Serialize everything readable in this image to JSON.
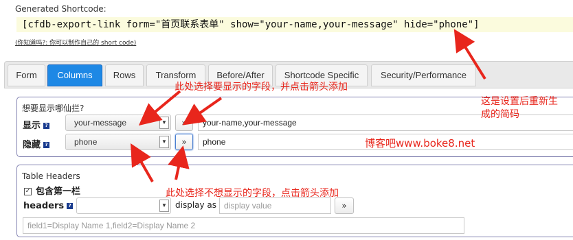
{
  "header": {
    "generated_label": "Generated Shortcode:",
    "shortcode": "[cfdb-export-link form=\"首页联系表单\" show=\"your-name,your-message\" hide=\"phone\"]",
    "hint_link": "(你知道吗?: 你可以制作自己的 short code)"
  },
  "tabs": [
    {
      "label": "Form"
    },
    {
      "label": "Columns"
    },
    {
      "label": "Rows"
    },
    {
      "label": "Transform"
    },
    {
      "label": "Before/After"
    },
    {
      "label": "Shortcode Specific"
    },
    {
      "label": "Security/Performance"
    }
  ],
  "columns_panel": {
    "legend": "想要显示哪仙拦?",
    "show_label": "显示",
    "show_select": "your-message",
    "show_value": "your-name,your-message",
    "hide_label": "隐藏",
    "hide_select": "phone",
    "hide_value": "phone",
    "add_button": "»"
  },
  "headers_panel": {
    "legend": "Table Headers",
    "include_first": "包含第一栏",
    "headers_label": "headers",
    "select_value": "",
    "display_as": "display as",
    "display_placeholder": "display value",
    "add_button": "»",
    "example_placeholder": "field1=Display Name 1,field2=Display Name 2"
  },
  "annotations": {
    "select_show": "此处选择要显示的字段，并点击箭头添加",
    "shortcode_note_1": "这是设置后重新生",
    "shortcode_note_2": "成的简码",
    "watermark": "博客吧www.boke8.net",
    "select_hide": "此处选择不想显示的字段，点击箭头添加"
  },
  "colors": {
    "accent": "#1e88e5",
    "annotation": "#e8261c",
    "shortcode_bg": "#fbfbdd",
    "fieldset_border": "#8080b0"
  },
  "icons": {
    "help": "help-icon",
    "dropdown": "chevron-down-icon",
    "checkbox": "checkbox-checked-icon"
  }
}
